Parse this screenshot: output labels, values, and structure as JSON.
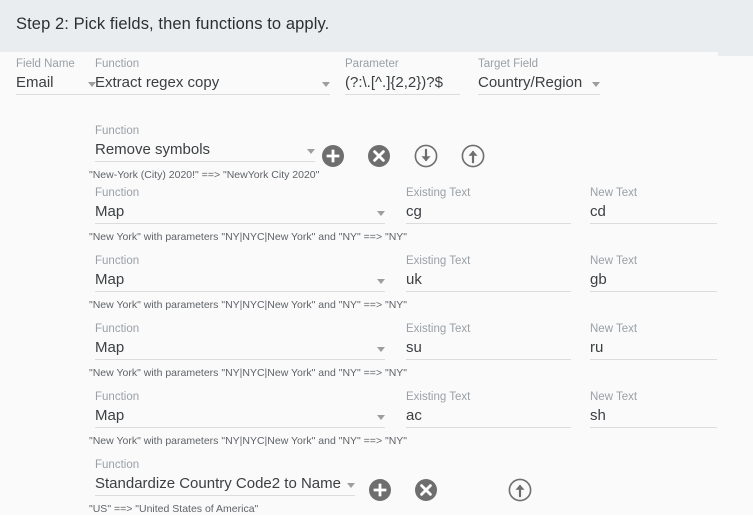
{
  "header": {
    "title": "Step 2: Pick fields, then functions to apply.",
    "background": "#eaedf0"
  },
  "top_row": {
    "field_name": {
      "label": "Field Name",
      "value": "Email"
    },
    "function": {
      "label": "Function",
      "value": "Extract regex copy"
    },
    "parameter": {
      "label": "Parameter",
      "value": "(?:\\.[^.]{2,2})?$"
    },
    "target_field": {
      "label": "Target Field",
      "value": "Country/Region"
    }
  },
  "labels": {
    "function": "Function",
    "existing_text": "Existing Text",
    "new_text": "New Text"
  },
  "icons": {
    "add": "plus-circle-icon",
    "remove": "x-circle-icon",
    "move_down": "arrow-down-circle-icon",
    "move_up": "arrow-up-circle-icon",
    "dropdown": "chevron-down-icon"
  },
  "function_rows": [
    {
      "function": "Remove symbols",
      "hint": "\"New-York (City) 2020!\" ==> \"NewYork City 2020\"",
      "has_text_fields": false,
      "buttons": [
        "add",
        "remove",
        "move_down",
        "move_up"
      ]
    },
    {
      "function": "Map",
      "hint": "\"New York\" with parameters \"NY|NYC|New York\" and \"NY\" ==> \"NY\"",
      "has_text_fields": true,
      "existing_text": "cg",
      "new_text": "cd",
      "buttons": []
    },
    {
      "function": "Map",
      "hint": "\"New York\" with parameters \"NY|NYC|New York\" and \"NY\" ==> \"NY\"",
      "has_text_fields": true,
      "existing_text": "uk",
      "new_text": "gb",
      "buttons": []
    },
    {
      "function": "Map",
      "hint": "\"New York\" with parameters \"NY|NYC|New York\" and \"NY\" ==> \"NY\"",
      "has_text_fields": true,
      "existing_text": "su",
      "new_text": "ru",
      "buttons": []
    },
    {
      "function": "Map",
      "hint": "\"New York\" with parameters \"NY|NYC|New York\" and \"NY\" ==> \"NY\"",
      "has_text_fields": true,
      "existing_text": "ac",
      "new_text": "sh",
      "buttons": []
    },
    {
      "function": "Standardize Country Code2 to Name",
      "hint": "\"US\" ==> \"United States of America\"",
      "has_text_fields": false,
      "buttons": [
        "add",
        "remove",
        "move_up"
      ]
    }
  ],
  "colors": {
    "surface": "#fafafa",
    "header": "#eaedf0",
    "text_primary": "#3c4043",
    "text_secondary": "#9aa0a6",
    "underline": "#dcdcdc",
    "icon_fill": "#6e6e6e"
  }
}
